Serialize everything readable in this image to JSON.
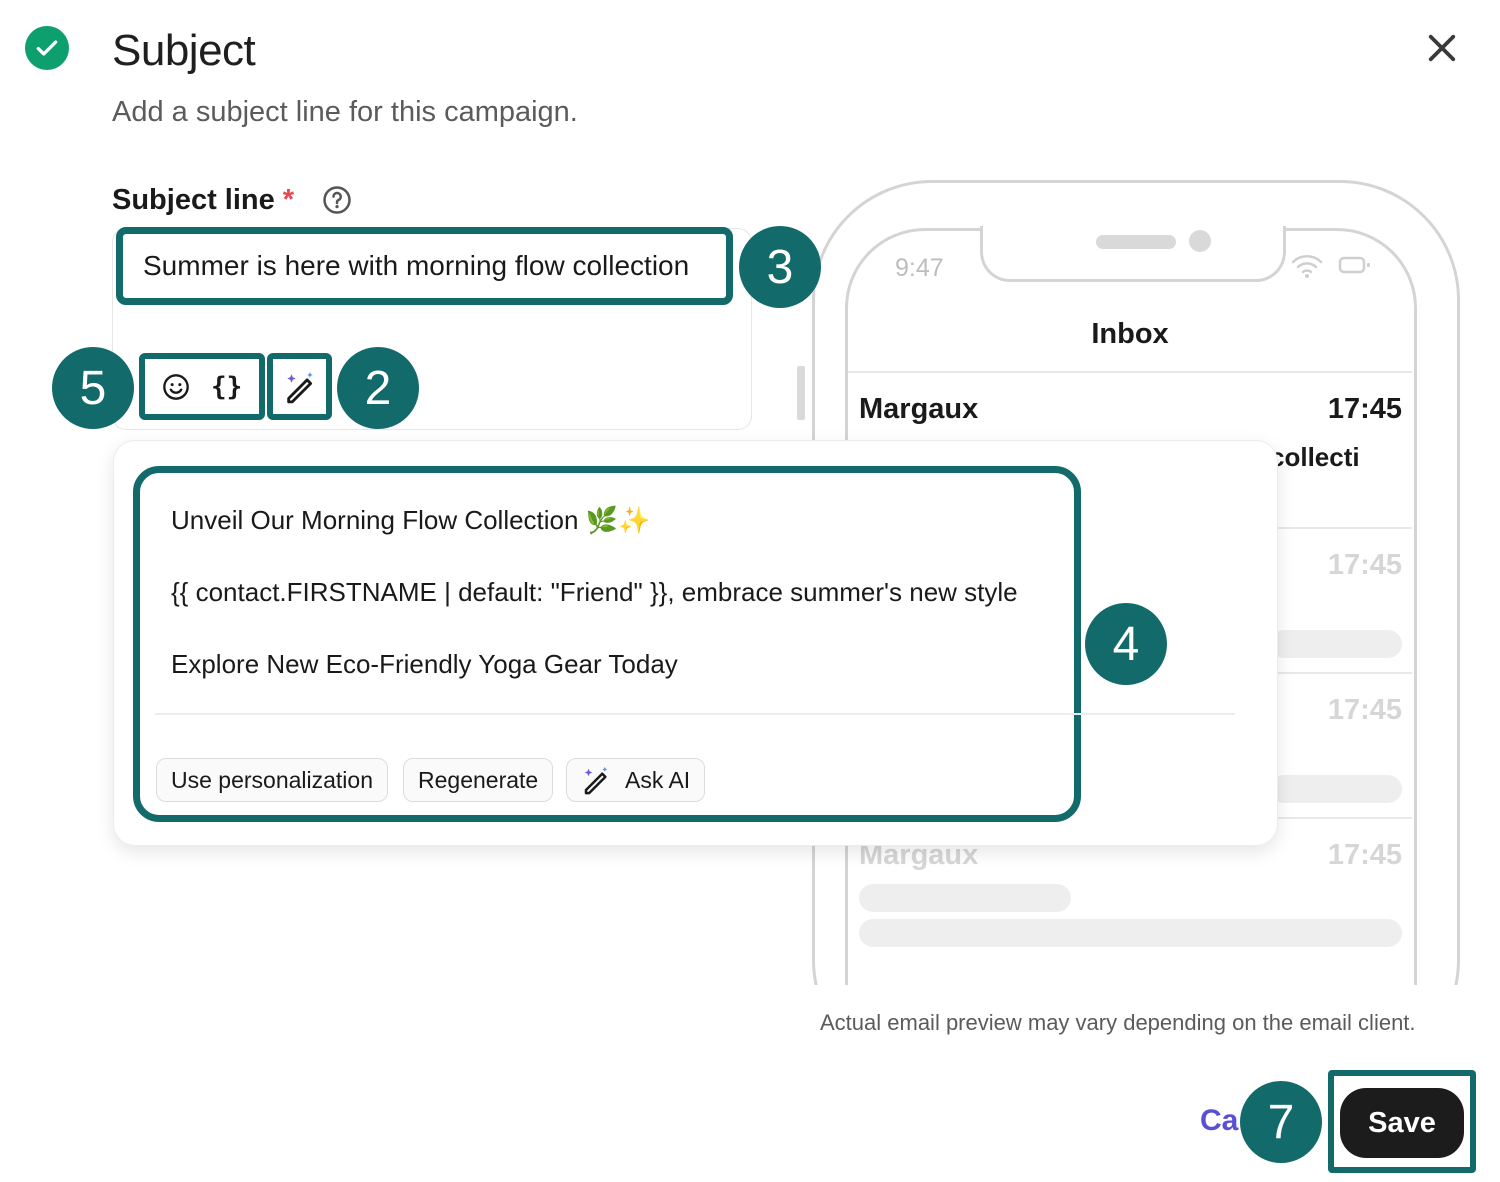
{
  "header": {
    "title": "Subject",
    "subtitle": "Add a subject line for this campaign."
  },
  "field": {
    "label": "Subject line",
    "required_mark": "*",
    "value": "Summer is here with morning flow collection"
  },
  "toolbar": {
    "variable_label": "{}"
  },
  "markers": {
    "two": "2",
    "three": "3",
    "four": "4",
    "five": "5",
    "seven": "7"
  },
  "phone": {
    "status_time": "9:47",
    "inbox_title": "Inbox",
    "rows": [
      {
        "sender": "Margaux",
        "time": "17:45",
        "subject_fragment": "collecti"
      },
      {
        "time": "17:45"
      },
      {
        "time": "17:45"
      },
      {
        "sender": "Margaux",
        "time": "17:45"
      }
    ]
  },
  "ai_popover": {
    "suggestions": [
      "Unveil Our Morning Flow Collection 🌿✨",
      "{{ contact.FIRSTNAME | default: \"Friend\" }}, embrace summer's new style",
      "Explore New Eco-Friendly Yoga Gear Today"
    ],
    "actions": {
      "personalize": "Use personalization",
      "regenerate": "Regenerate",
      "ask_ai": "Ask AI"
    }
  },
  "footer": {
    "disclaimer": "Actual email preview may vary depending on the email client.",
    "cancel": "Ca",
    "save": "Save"
  },
  "colors": {
    "marker_teal": "#136a6a",
    "success_green": "#0e9f6e",
    "link_purple": "#5b4fd6",
    "save_bg": "#1c1c1c"
  }
}
